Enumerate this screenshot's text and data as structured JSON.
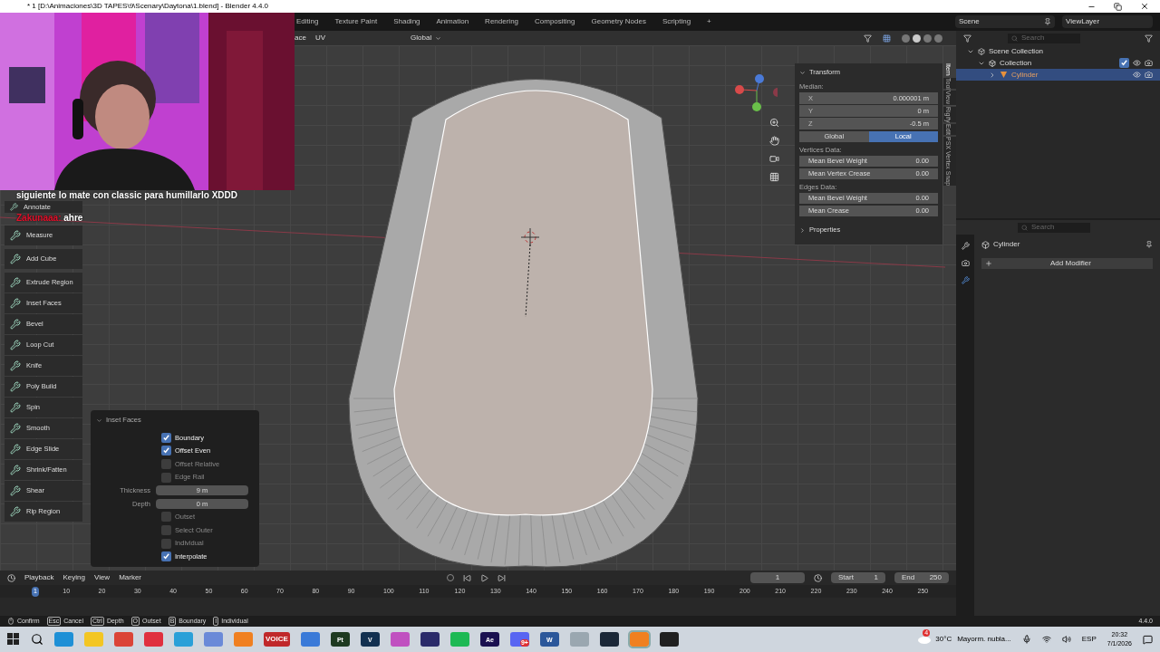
{
  "window": {
    "title": "* 1 [D:\\Animaciones\\3D TAPES\\9\\Scenary\\Daytona\\1.blend] - Blender 4.4.0"
  },
  "workspace_tabs": [
    {
      "label": "Editing",
      "selected": false
    },
    {
      "label": "Texture Paint",
      "selected": false
    },
    {
      "label": "Shading",
      "selected": false
    },
    {
      "label": "Animation",
      "selected": false
    },
    {
      "label": "Rendering",
      "selected": false
    },
    {
      "label": "Compositing",
      "selected": false
    },
    {
      "label": "Geometry Nodes",
      "selected": false
    },
    {
      "label": "Scripting",
      "selected": false
    },
    {
      "label": "+",
      "selected": false
    }
  ],
  "scene": "Scene",
  "view_layer": "ViewLayer",
  "viewport_header": {
    "menus": [
      "ace",
      "UV"
    ],
    "orientation": "Global"
  },
  "chat": [
    {
      "text": "siguiente lo mate con classic para humillarlo XDDD"
    },
    {
      "user": "Zakunaaa:",
      "text": "ahre"
    }
  ],
  "toolbar": [
    {
      "tools": [
        "Annotate",
        "Measure"
      ]
    },
    {
      "tools": [
        "Add Cube"
      ]
    },
    {
      "tools": [
        "Extrude Region",
        "Inset Faces",
        "Bevel",
        "Loop Cut",
        "Knife",
        "Poly Build",
        "Spin",
        "Smooth",
        "Edge Slide",
        "Shrink/Fatten",
        "Shear",
        "Rip Region"
      ]
    }
  ],
  "operator_panel": {
    "title": "Inset Faces",
    "options": [
      {
        "kind": "checkbox",
        "label": "Boundary",
        "checked": true
      },
      {
        "kind": "checkbox",
        "label": "Offset Even",
        "checked": true
      },
      {
        "kind": "checkbox",
        "label": "Offset Relative",
        "checked": false
      },
      {
        "kind": "checkbox",
        "label": "Edge Rail",
        "checked": false
      },
      {
        "kind": "number",
        "label": "Thickness",
        "value": "9 m"
      },
      {
        "kind": "number",
        "label": "Depth",
        "value": "0 m"
      },
      {
        "kind": "checkbox",
        "label": "Outset",
        "checked": false
      },
      {
        "kind": "checkbox",
        "label": "Select Outer",
        "checked": false
      },
      {
        "kind": "checkbox",
        "label": "Individual",
        "checked": false
      },
      {
        "kind": "checkbox",
        "label": "Interpolate",
        "checked": true
      }
    ]
  },
  "sidebar": {
    "tabs": [
      {
        "label": "Item",
        "selected": true
      },
      {
        "label": "Tool",
        "selected": false
      },
      {
        "label": "View",
        "selected": false
      },
      {
        "label": "Rigify",
        "selected": false
      },
      {
        "label": "Edit",
        "selected": false
      },
      {
        "label": "PSX Vertex Snap",
        "selected": false
      }
    ],
    "transform": {
      "title": "Transform",
      "median_label": "Median:",
      "fields": [
        {
          "axis": "X",
          "value": "0.000001 m"
        },
        {
          "axis": "Y",
          "value": "0 m"
        },
        {
          "axis": "Z",
          "value": "-0.5 m"
        }
      ],
      "space": [
        {
          "label": "Global",
          "selected": false
        },
        {
          "label": "Local",
          "selected": true
        }
      ],
      "vertices_label": "Vertices Data:",
      "vertices": [
        {
          "label": "Mean Bevel Weight",
          "value": "0.00"
        },
        {
          "label": "Mean Vertex Crease",
          "value": "0.00"
        }
      ],
      "edges_label": "Edges Data:",
      "edges": [
        {
          "label": "Mean Bevel Weight",
          "value": "0.00"
        },
        {
          "label": "Mean Crease",
          "value": "0.00"
        }
      ]
    },
    "properties": "Properties"
  },
  "outliner": {
    "search_placeholder": "Search",
    "tree": [
      {
        "label": "Scene Collection",
        "kind": "scene",
        "selected": false,
        "children": [
          {
            "label": "Collection",
            "kind": "collection",
            "selected": false,
            "checked": true,
            "children": [
              {
                "label": "Cylinder",
                "kind": "object",
                "selected": true
              }
            ]
          }
        ]
      }
    ]
  },
  "properties_editor": {
    "search_placeholder": "Search",
    "object": "Cylinder",
    "add_modifier": "Add Modifier"
  },
  "timeline": {
    "menus": [
      "Playback",
      "Keying",
      "View",
      "Marker"
    ],
    "current_frame": "1",
    "start_label": "Start",
    "start": "1",
    "end_label": "End",
    "end": "250",
    "ruler": [
      "1",
      "10",
      "20",
      "30",
      "40",
      "50",
      "60",
      "70",
      "80",
      "90",
      "100",
      "110",
      "120",
      "130",
      "140",
      "150",
      "160",
      "170",
      "180",
      "190",
      "200",
      "210",
      "220",
      "230",
      "240",
      "250"
    ]
  },
  "status_bar": {
    "hints": [
      {
        "label": "Confirm"
      },
      {
        "key": "Esc",
        "label": "Cancel"
      },
      {
        "key": "Ctrl",
        "label": "Depth"
      },
      {
        "key": "O",
        "label": "Outset"
      },
      {
        "key": "B",
        "label": "Boundary"
      },
      {
        "key": "I",
        "label": "Individual"
      }
    ],
    "version": "4.4.0"
  },
  "taskbar": {
    "apps": [
      {
        "color": "#1e90d6"
      },
      {
        "color": "#f3c623"
      },
      {
        "color": "#db4437"
      },
      {
        "color": "#e0303f"
      },
      {
        "color": "#2aa0d8"
      },
      {
        "color": "#6a8ad8"
      },
      {
        "color": "#f08020"
      },
      {
        "color": "#c0282a",
        "glyph": "VOICE"
      },
      {
        "color": "#3a7ad8"
      },
      {
        "color": "#1e3a20",
        "glyph": "Pt"
      },
      {
        "color": "#123050",
        "glyph": "V"
      },
      {
        "color": "#c050c0"
      },
      {
        "color": "#2b2b6a"
      },
      {
        "color": "#1db954"
      },
      {
        "color": "#1a1050",
        "glyph": "Ae"
      },
      {
        "color": "#5865f2",
        "badge": "9+"
      },
      {
        "color": "#2b579a",
        "glyph": "W"
      },
      {
        "color": "#9aa7b0"
      },
      {
        "color": "#1b2838"
      },
      {
        "color": "#f08020",
        "selected": true
      },
      {
        "color": "#202020"
      }
    ],
    "weather_badge": "4",
    "temperature": "30°C",
    "weather": "Mayorm. nubla...",
    "language": "ESP",
    "time": "20:32",
    "date": "7/1/2026"
  }
}
